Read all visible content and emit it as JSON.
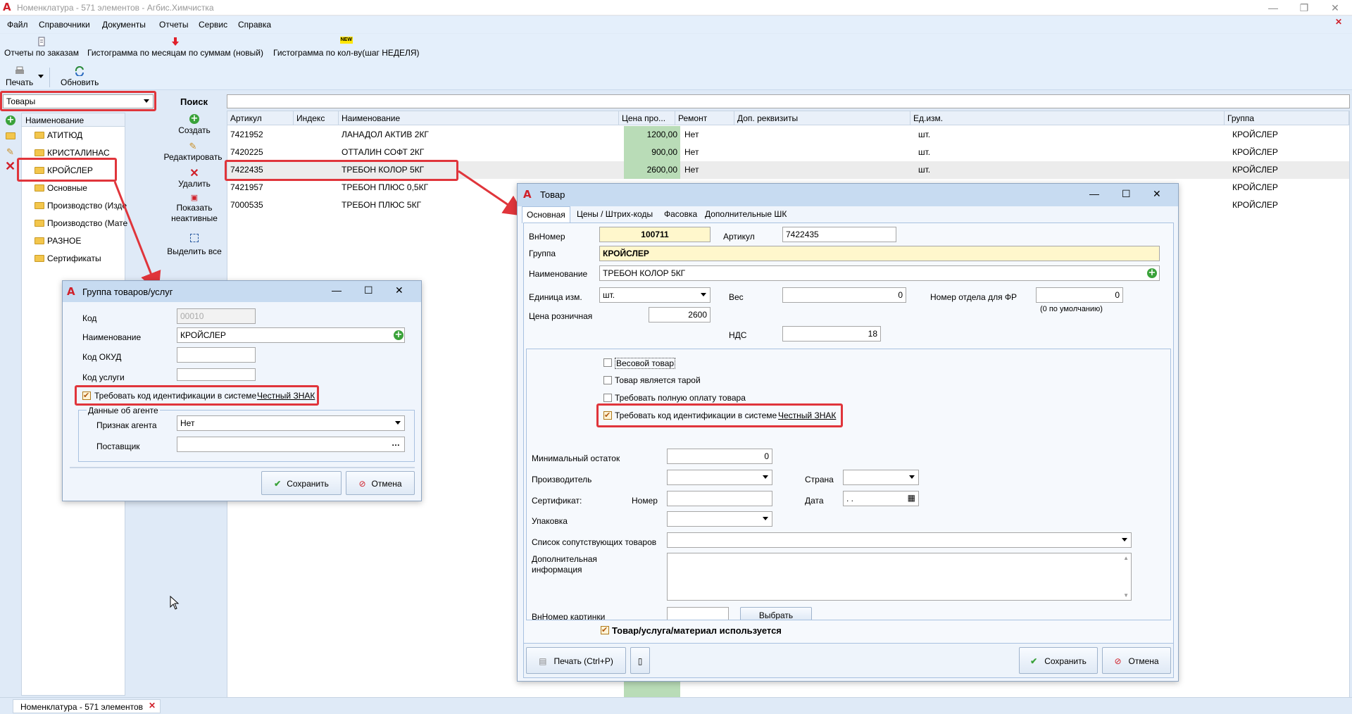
{
  "window": {
    "title": "Номенклатура - 571 элементов - Агбис.Химчистка"
  },
  "menu": [
    "Файл",
    "Справочники",
    "Документы",
    "Отчеты",
    "Сервис",
    "Справка"
  ],
  "ribbon": {
    "reports_orders": "Отчеты по заказам",
    "hist_month": "Гистограмма по месяцам по суммам (новый)",
    "hist_count": "Гистограмма по кол-ву(шаг НЕДЕЛЯ)",
    "new_badge": "NEW",
    "print": "Печать",
    "refresh": "Обновить"
  },
  "category_combo": "Товары",
  "search_label": "Поиск",
  "actions": {
    "create": "Создать",
    "edit": "Редактировать",
    "delete": "Удалить",
    "show_inactive_1": "Показать",
    "show_inactive_2": "неактивные",
    "select_all": "Выделить все"
  },
  "tree": {
    "header": "Наименование",
    "items": [
      "АТИТЮД",
      "КРИСТАЛИНАС",
      "КРОЙСЛЕР",
      "Основные",
      "Производство (Изде",
      "Производство (Мате",
      "РАЗНОЕ",
      "Сертификаты"
    ]
  },
  "grid": {
    "columns": [
      "Артикул",
      "Индекс",
      "Наименование",
      "Цена про...",
      "Ремонт",
      "Доп. реквизиты",
      "Ед.изм.",
      "Группа"
    ],
    "rows": [
      {
        "art": "7421952",
        "name": "ЛАНАДОЛ АКТИВ 2КГ",
        "price": "1200,00",
        "repair": "Нет",
        "unit": "шт.",
        "group": "КРОЙСЛЕР"
      },
      {
        "art": "7420225",
        "name": "ОТТАЛИН СОФТ 2КГ",
        "price": "900,00",
        "repair": "Нет",
        "unit": "шт.",
        "group": "КРОЙСЛЕР"
      },
      {
        "art": "7422435",
        "name": "ТРЕБОН КОЛОР 5КГ",
        "price": "2600,00",
        "repair": "Нет",
        "unit": "шт.",
        "group": "КРОЙСЛЕР"
      },
      {
        "art": "7421957",
        "name": "ТРЕБОН ПЛЮС 0,5КГ",
        "price": "",
        "repair": "",
        "unit": "",
        "group": "КРОЙСЛЕР"
      },
      {
        "art": "7000535",
        "name": "ТРЕБОН ПЛЮС 5КГ",
        "price": "",
        "repair": "",
        "unit": "",
        "group": "КРОЙСЛЕР"
      }
    ]
  },
  "group_dialog": {
    "title": "Группа товаров/услуг",
    "code_label": "Код",
    "code": "00010",
    "name_label": "Наименование",
    "name": "КРОЙСЛЕР",
    "okud_label": "Код ОКУД",
    "service_label": "Код услуги",
    "require_code": "Требовать код идентификации в системе",
    "honest_sign": "Честный ЗНАК",
    "agent_group": "Данные об агенте",
    "agent_sign_label": "Признак агента",
    "agent_sign": "Нет",
    "supplier_label": "Поставщик",
    "save": "Сохранить",
    "cancel": "Отмена"
  },
  "product_dialog": {
    "title": "Товар",
    "tabs": [
      "Основная",
      "Цены / Штрих-коды",
      "Фасовка",
      "Дополнительные ШК"
    ],
    "innum_label": "ВнНомер",
    "innum": "100711",
    "art_label": "Артикул",
    "art": "7422435",
    "group_label": "Группа",
    "group": "КРОЙСЛЕР",
    "name_label": "Наименование",
    "name": "ТРЕБОН КОЛОР 5КГ",
    "unit_label": "Единица изм.",
    "unit": "шт.",
    "weight_label": "Вес",
    "weight": "0",
    "dept_label": "Номер отдела для ФР",
    "dept": "0",
    "dept_hint": "(0 по умолчанию)",
    "price_label": "Цена розничная",
    "price": "2600",
    "vat_label": "НДС",
    "vat": "18",
    "weighted": "Весовой товар",
    "tare": "Товар является тарой",
    "full_pay": "Требовать полную оплату товара",
    "require_code": "Требовать код идентификации в системе",
    "honest_sign": "Честный ЗНАК",
    "min_rest_label": "Минимальный остаток",
    "min_rest": "0",
    "producer_label": "Производитель",
    "country_label": "Страна",
    "cert_label": "Сертификат:",
    "number_label": "Номер",
    "date_label": "Дата",
    "date": " .  .",
    "pack_label": "Упаковка",
    "related_label": "Список сопутствующих товаров",
    "addinfo_label_1": "Дополнительная",
    "addinfo_label_2": "информация",
    "pic_label": "ВнНомер картинки",
    "choose": "Выбрать",
    "used": "Товар/услуга/материал используется",
    "print": "Печать (Ctrl+P)",
    "save": "Сохранить",
    "cancel": "Отмена"
  },
  "status": {
    "tab": "Номенклатура - 571 элементов"
  }
}
